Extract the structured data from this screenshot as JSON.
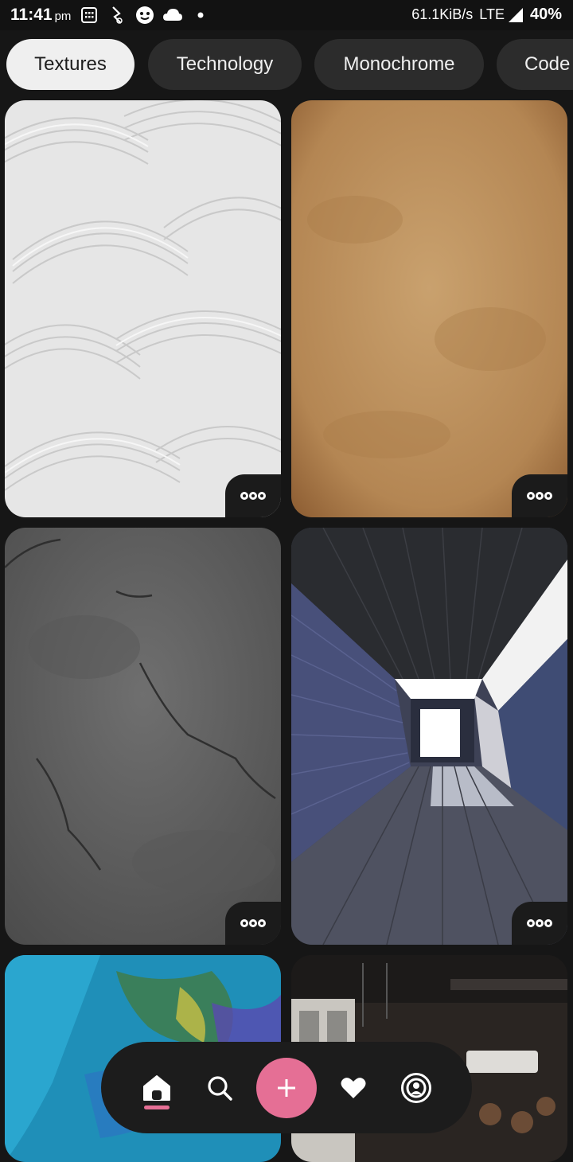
{
  "status_bar": {
    "time": "11:41",
    "ampm": "pm",
    "net_speed": "61.1KiB/s",
    "network": "LTE",
    "battery": "40%"
  },
  "categories": [
    {
      "label": "Textures",
      "active": true
    },
    {
      "label": "Technology",
      "active": false
    },
    {
      "label": "Monochrome",
      "active": false
    },
    {
      "label": "Code",
      "active": false
    }
  ],
  "wallpapers": [
    {
      "name": "white-plaster-texture",
      "more_icon": "more-dots-icon"
    },
    {
      "name": "brown-paper-texture",
      "more_icon": "more-dots-icon"
    },
    {
      "name": "grey-stone-texture",
      "more_icon": "more-dots-icon"
    },
    {
      "name": "tunnel-perspective",
      "more_icon": "more-dots-icon"
    },
    {
      "name": "blue-paint-texture"
    },
    {
      "name": "industrial-interior"
    }
  ],
  "bottom_nav": {
    "items": [
      "home-icon",
      "search-icon",
      "add-icon",
      "favorites-icon",
      "profile-icon"
    ],
    "accent": "#e56f95"
  }
}
